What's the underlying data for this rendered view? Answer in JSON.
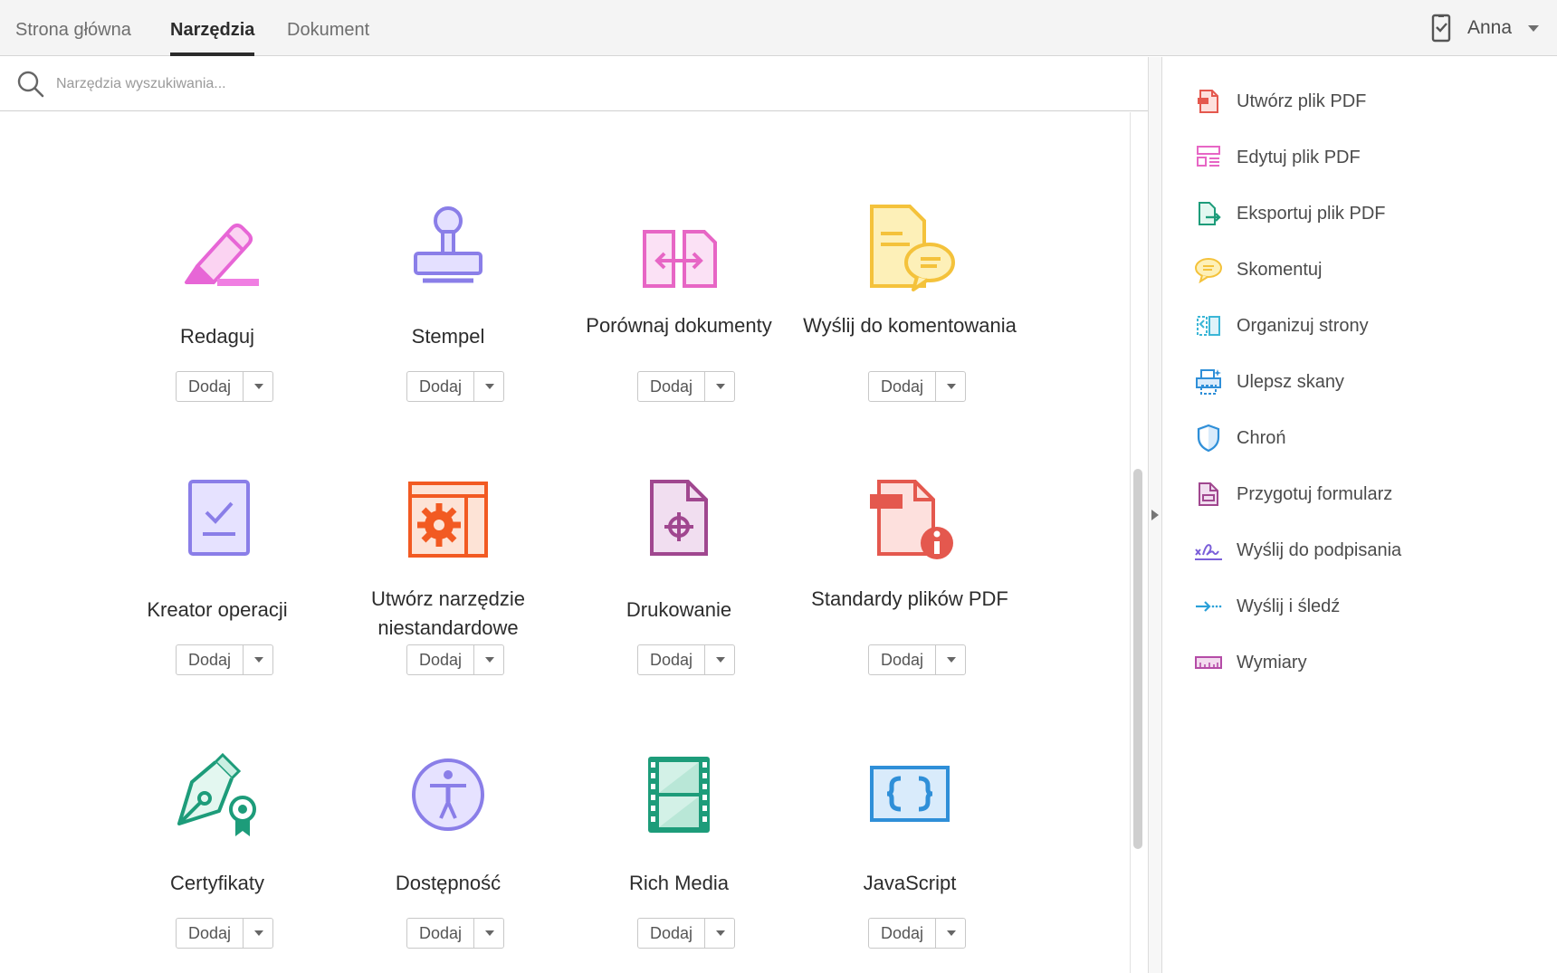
{
  "tabs": [
    "Strona główna",
    "Narzędzia",
    "Dokument"
  ],
  "user": {
    "name": "Anna"
  },
  "search": {
    "placeholder": "Narzędzia wyszukiwania..."
  },
  "tools": [
    {
      "label": "Redaguj",
      "add": "Dodaj"
    },
    {
      "label": "Stempel",
      "add": "Dodaj"
    },
    {
      "label": "Porównaj dokumenty",
      "add": "Dodaj"
    },
    {
      "label": "Wyślij do komentowania",
      "add": "Dodaj"
    },
    {
      "label": "Kreator operacji",
      "add": "Dodaj"
    },
    {
      "label": "Utwórz narzędzie niestandardowe",
      "add": "Dodaj"
    },
    {
      "label": "Drukowanie",
      "add": "Dodaj"
    },
    {
      "label": "Standardy plików PDF",
      "add": "Dodaj"
    },
    {
      "label": "Certyfikaty",
      "add": "Dodaj"
    },
    {
      "label": "Dostępność",
      "add": "Dodaj"
    },
    {
      "label": "Rich Media",
      "add": "Dodaj"
    },
    {
      "label": "JavaScript",
      "add": "Dodaj"
    }
  ],
  "right_panel": [
    {
      "label": "Utwórz plik PDF",
      "icon": "create-pdf-icon",
      "color": "#e4584e"
    },
    {
      "label": "Edytuj plik PDF",
      "icon": "edit-pdf-icon",
      "color": "#e766c5"
    },
    {
      "label": "Eksportuj plik PDF",
      "icon": "export-pdf-icon",
      "color": "#1d9c7a"
    },
    {
      "label": "Skomentuj",
      "icon": "comment-icon",
      "color": "#f4c23b"
    },
    {
      "label": "Organizuj strony",
      "icon": "organize-pages-icon",
      "color": "#3bb6d6"
    },
    {
      "label": "Ulepsz skany",
      "icon": "enhance-scans-icon",
      "color": "#2f8fd8"
    },
    {
      "label": "Chroń",
      "icon": "protect-shield-icon",
      "color": "#2f8fd8"
    },
    {
      "label": "Przygotuj formularz",
      "icon": "prepare-form-icon",
      "color": "#a0478f"
    },
    {
      "label": "Wyślij do podpisania",
      "icon": "send-for-signature-icon",
      "color": "#7b5fd9"
    },
    {
      "label": "Wyślij i śledź",
      "icon": "send-and-track-icon",
      "color": "#2aa0d8"
    },
    {
      "label": "Wymiary",
      "icon": "measure-ruler-icon",
      "color": "#b54ca7"
    }
  ]
}
